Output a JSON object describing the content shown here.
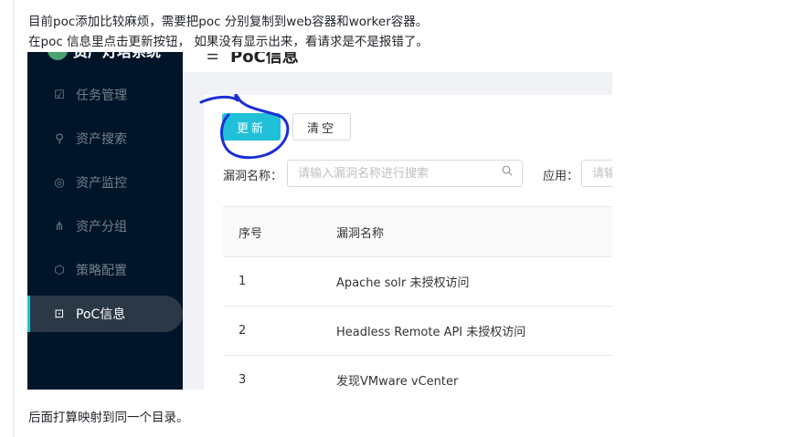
{
  "notes": {
    "line1": "目前poc添加比较麻烦，需要把poc 分别复制到web容器和worker容器。",
    "line2": "在poc 信息里点击更新按钮， 如果没有显示出来，看请求是不是报错了。",
    "line3": "后面打算映射到同一个目录。"
  },
  "app": {
    "brand": "资产灯塔系统",
    "page_title": "PoC信息"
  },
  "sidebar": {
    "items": [
      {
        "label": "任务管理",
        "icon": "task-icon"
      },
      {
        "label": "资产搜索",
        "icon": "search-icon"
      },
      {
        "label": "资产监控",
        "icon": "monitor-icon"
      },
      {
        "label": "资产分组",
        "icon": "group-icon"
      },
      {
        "label": "策略配置",
        "icon": "policy-icon"
      },
      {
        "label": "PoC信息",
        "icon": "terminal-icon",
        "active": true
      }
    ]
  },
  "toolbar": {
    "update_label": "更新",
    "clear_label": "清空"
  },
  "filters": {
    "vuln_name_label": "漏洞名称：",
    "vuln_name_placeholder": "请输入漏洞名称进行搜索",
    "app_label": "应用：",
    "app_placeholder": "请输"
  },
  "table": {
    "headers": [
      "序号",
      "漏洞名称"
    ],
    "rows": [
      [
        "1",
        "Apache solr 未授权访问"
      ],
      [
        "2",
        "Headless Remote API 未授权访问"
      ],
      [
        "3",
        "发现VMware vCenter"
      ]
    ]
  },
  "colors": {
    "accent": "#20c0d8",
    "sidebar_bg": "#001529",
    "annotation": "#1a2fd6"
  }
}
